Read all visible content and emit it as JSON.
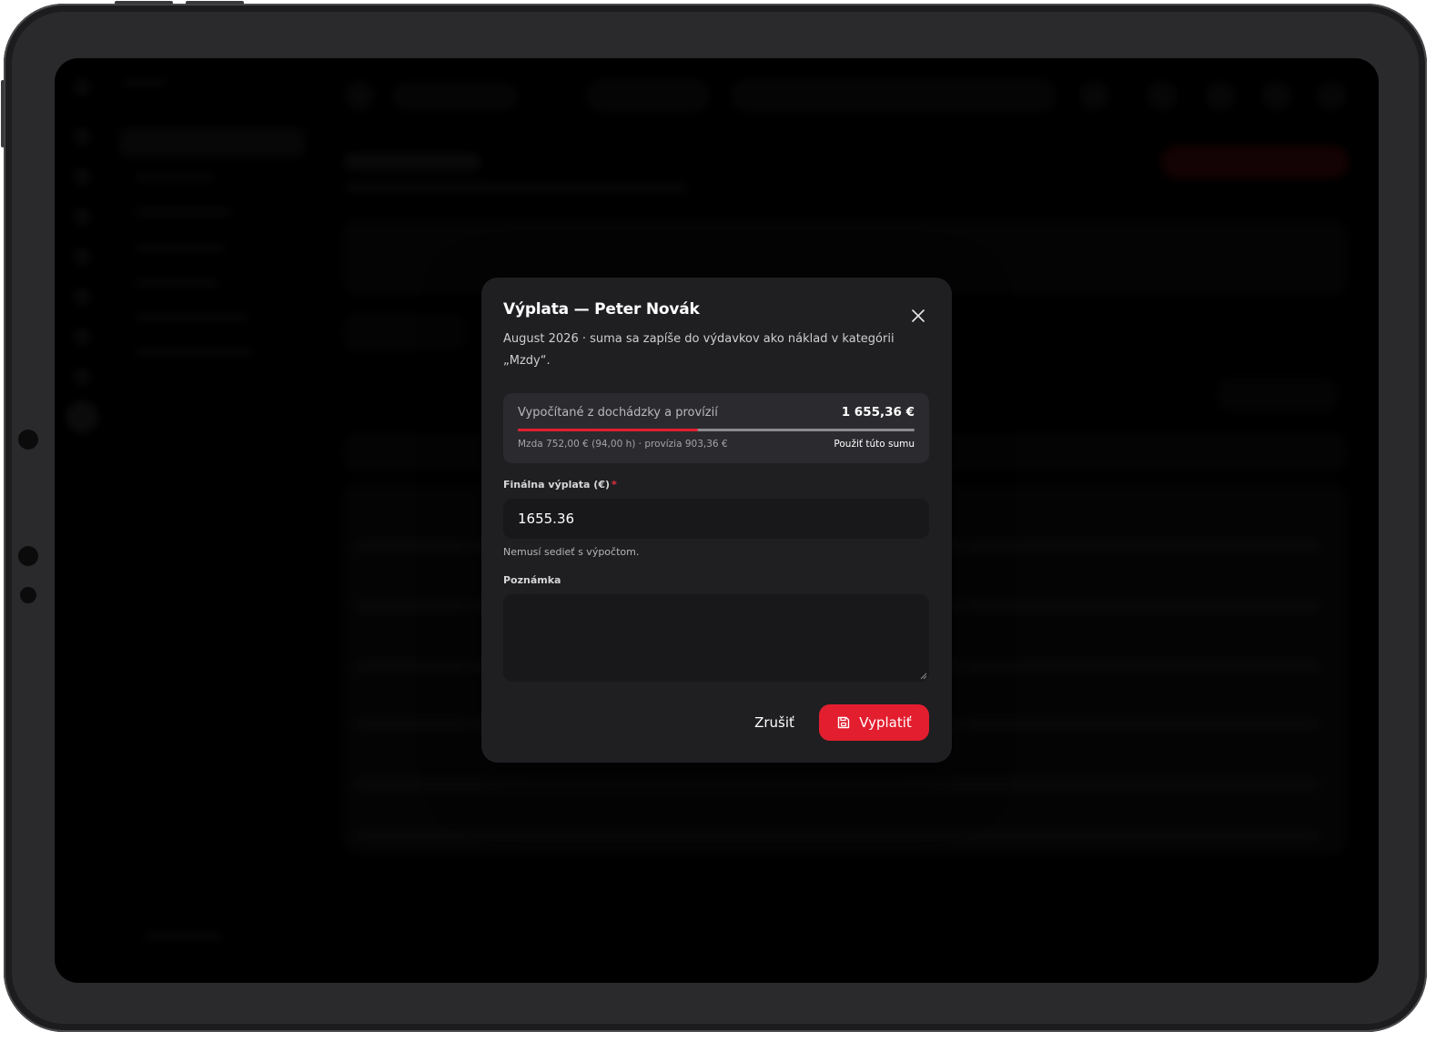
{
  "modal": {
    "title": "Výplata — Peter Novák",
    "description": "August 2026 · suma sa zapíše do výdavkov ako náklad v kategórii „Mzdy“.",
    "close_icon": "close-icon",
    "calc": {
      "label": "Vypočítané z dochádzky a provízií",
      "value": "1 655,36 €",
      "detail": "Mzda 752,00 € (94,00 h) · provízia 903,36 €",
      "use_sum_label": "Použiť túto sumu",
      "wage_share": 0.454
    },
    "amount_field": {
      "label": "Finálna výplata (€)",
      "required_mark": "*",
      "value": "1655.36",
      "hint": "Nemusí sedieť s výpočtom."
    },
    "note_field": {
      "label": "Poznámka",
      "value": ""
    },
    "cancel_label": "Zrušiť",
    "submit_label": "Vyplatiť",
    "submit_icon": "save-icon"
  },
  "colors": {
    "accent": "#e31e2f",
    "modal_bg": "#1f1f22",
    "input_bg": "#18181a",
    "calc_bg": "#2b2b2f"
  }
}
